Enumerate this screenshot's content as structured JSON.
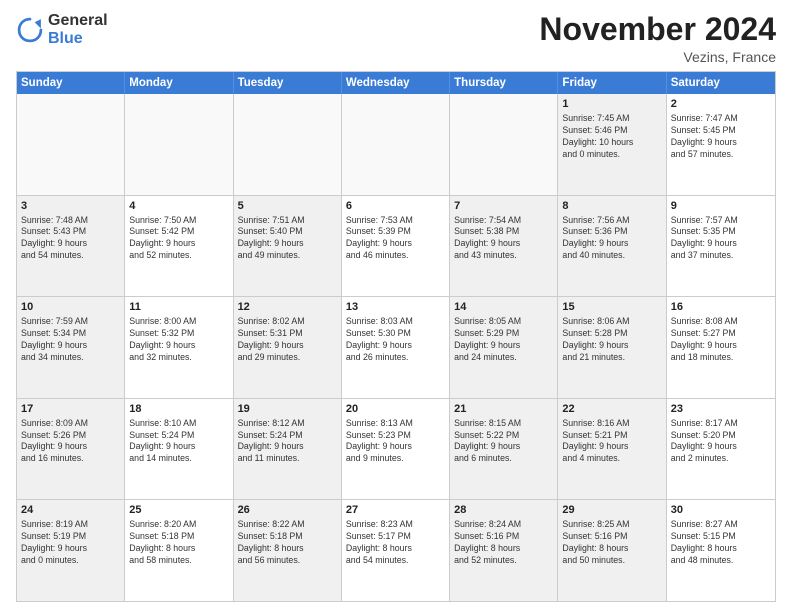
{
  "logo": {
    "general": "General",
    "blue": "Blue"
  },
  "title": "November 2024",
  "location": "Vezins, France",
  "days": [
    "Sunday",
    "Monday",
    "Tuesday",
    "Wednesday",
    "Thursday",
    "Friday",
    "Saturday"
  ],
  "rows": [
    [
      {
        "day": "",
        "lines": [],
        "empty": true
      },
      {
        "day": "",
        "lines": [],
        "empty": true
      },
      {
        "day": "",
        "lines": [],
        "empty": true
      },
      {
        "day": "",
        "lines": [],
        "empty": true
      },
      {
        "day": "",
        "lines": [],
        "empty": true
      },
      {
        "day": "1",
        "lines": [
          "Sunrise: 7:45 AM",
          "Sunset: 5:46 PM",
          "Daylight: 10 hours",
          "and 0 minutes."
        ],
        "shaded": true
      },
      {
        "day": "2",
        "lines": [
          "Sunrise: 7:47 AM",
          "Sunset: 5:45 PM",
          "Daylight: 9 hours",
          "and 57 minutes."
        ],
        "shaded": false
      }
    ],
    [
      {
        "day": "3",
        "lines": [
          "Sunrise: 7:48 AM",
          "Sunset: 5:43 PM",
          "Daylight: 9 hours",
          "and 54 minutes."
        ],
        "shaded": true
      },
      {
        "day": "4",
        "lines": [
          "Sunrise: 7:50 AM",
          "Sunset: 5:42 PM",
          "Daylight: 9 hours",
          "and 52 minutes."
        ],
        "shaded": false
      },
      {
        "day": "5",
        "lines": [
          "Sunrise: 7:51 AM",
          "Sunset: 5:40 PM",
          "Daylight: 9 hours",
          "and 49 minutes."
        ],
        "shaded": true
      },
      {
        "day": "6",
        "lines": [
          "Sunrise: 7:53 AM",
          "Sunset: 5:39 PM",
          "Daylight: 9 hours",
          "and 46 minutes."
        ],
        "shaded": false
      },
      {
        "day": "7",
        "lines": [
          "Sunrise: 7:54 AM",
          "Sunset: 5:38 PM",
          "Daylight: 9 hours",
          "and 43 minutes."
        ],
        "shaded": true
      },
      {
        "day": "8",
        "lines": [
          "Sunrise: 7:56 AM",
          "Sunset: 5:36 PM",
          "Daylight: 9 hours",
          "and 40 minutes."
        ],
        "shaded": true
      },
      {
        "day": "9",
        "lines": [
          "Sunrise: 7:57 AM",
          "Sunset: 5:35 PM",
          "Daylight: 9 hours",
          "and 37 minutes."
        ],
        "shaded": false
      }
    ],
    [
      {
        "day": "10",
        "lines": [
          "Sunrise: 7:59 AM",
          "Sunset: 5:34 PM",
          "Daylight: 9 hours",
          "and 34 minutes."
        ],
        "shaded": true
      },
      {
        "day": "11",
        "lines": [
          "Sunrise: 8:00 AM",
          "Sunset: 5:32 PM",
          "Daylight: 9 hours",
          "and 32 minutes."
        ],
        "shaded": false
      },
      {
        "day": "12",
        "lines": [
          "Sunrise: 8:02 AM",
          "Sunset: 5:31 PM",
          "Daylight: 9 hours",
          "and 29 minutes."
        ],
        "shaded": true
      },
      {
        "day": "13",
        "lines": [
          "Sunrise: 8:03 AM",
          "Sunset: 5:30 PM",
          "Daylight: 9 hours",
          "and 26 minutes."
        ],
        "shaded": false
      },
      {
        "day": "14",
        "lines": [
          "Sunrise: 8:05 AM",
          "Sunset: 5:29 PM",
          "Daylight: 9 hours",
          "and 24 minutes."
        ],
        "shaded": true
      },
      {
        "day": "15",
        "lines": [
          "Sunrise: 8:06 AM",
          "Sunset: 5:28 PM",
          "Daylight: 9 hours",
          "and 21 minutes."
        ],
        "shaded": true
      },
      {
        "day": "16",
        "lines": [
          "Sunrise: 8:08 AM",
          "Sunset: 5:27 PM",
          "Daylight: 9 hours",
          "and 18 minutes."
        ],
        "shaded": false
      }
    ],
    [
      {
        "day": "17",
        "lines": [
          "Sunrise: 8:09 AM",
          "Sunset: 5:26 PM",
          "Daylight: 9 hours",
          "and 16 minutes."
        ],
        "shaded": true
      },
      {
        "day": "18",
        "lines": [
          "Sunrise: 8:10 AM",
          "Sunset: 5:24 PM",
          "Daylight: 9 hours",
          "and 14 minutes."
        ],
        "shaded": false
      },
      {
        "day": "19",
        "lines": [
          "Sunrise: 8:12 AM",
          "Sunset: 5:24 PM",
          "Daylight: 9 hours",
          "and 11 minutes."
        ],
        "shaded": true
      },
      {
        "day": "20",
        "lines": [
          "Sunrise: 8:13 AM",
          "Sunset: 5:23 PM",
          "Daylight: 9 hours",
          "and 9 minutes."
        ],
        "shaded": false
      },
      {
        "day": "21",
        "lines": [
          "Sunrise: 8:15 AM",
          "Sunset: 5:22 PM",
          "Daylight: 9 hours",
          "and 6 minutes."
        ],
        "shaded": true
      },
      {
        "day": "22",
        "lines": [
          "Sunrise: 8:16 AM",
          "Sunset: 5:21 PM",
          "Daylight: 9 hours",
          "and 4 minutes."
        ],
        "shaded": true
      },
      {
        "day": "23",
        "lines": [
          "Sunrise: 8:17 AM",
          "Sunset: 5:20 PM",
          "Daylight: 9 hours",
          "and 2 minutes."
        ],
        "shaded": false
      }
    ],
    [
      {
        "day": "24",
        "lines": [
          "Sunrise: 8:19 AM",
          "Sunset: 5:19 PM",
          "Daylight: 9 hours",
          "and 0 minutes."
        ],
        "shaded": true
      },
      {
        "day": "25",
        "lines": [
          "Sunrise: 8:20 AM",
          "Sunset: 5:18 PM",
          "Daylight: 8 hours",
          "and 58 minutes."
        ],
        "shaded": false
      },
      {
        "day": "26",
        "lines": [
          "Sunrise: 8:22 AM",
          "Sunset: 5:18 PM",
          "Daylight: 8 hours",
          "and 56 minutes."
        ],
        "shaded": true
      },
      {
        "day": "27",
        "lines": [
          "Sunrise: 8:23 AM",
          "Sunset: 5:17 PM",
          "Daylight: 8 hours",
          "and 54 minutes."
        ],
        "shaded": false
      },
      {
        "day": "28",
        "lines": [
          "Sunrise: 8:24 AM",
          "Sunset: 5:16 PM",
          "Daylight: 8 hours",
          "and 52 minutes."
        ],
        "shaded": true
      },
      {
        "day": "29",
        "lines": [
          "Sunrise: 8:25 AM",
          "Sunset: 5:16 PM",
          "Daylight: 8 hours",
          "and 50 minutes."
        ],
        "shaded": true
      },
      {
        "day": "30",
        "lines": [
          "Sunrise: 8:27 AM",
          "Sunset: 5:15 PM",
          "Daylight: 8 hours",
          "and 48 minutes."
        ],
        "shaded": false
      }
    ]
  ]
}
